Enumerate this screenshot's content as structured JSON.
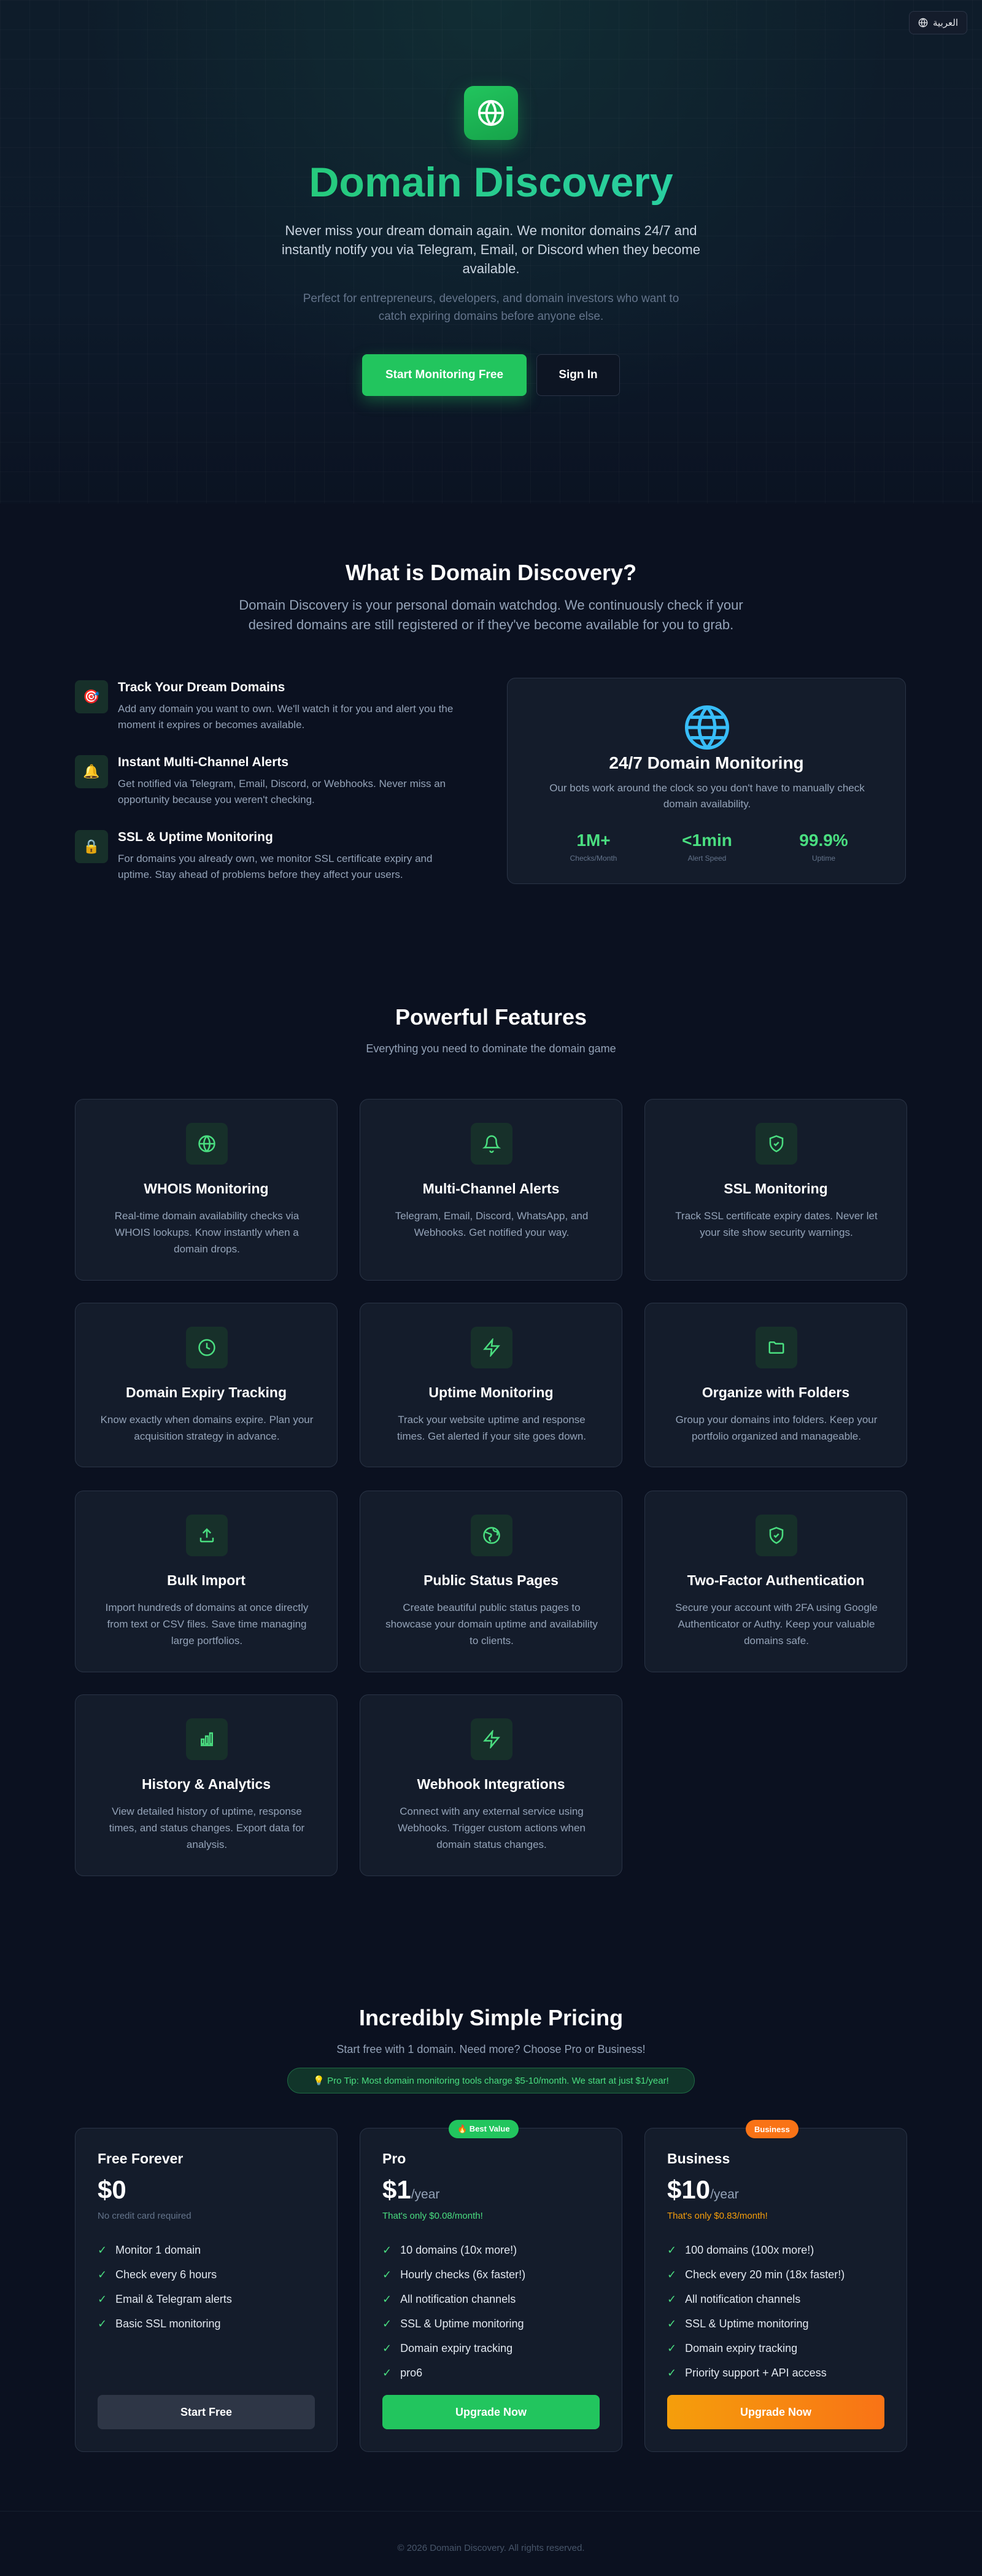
{
  "lang_button": {
    "label": "العربية"
  },
  "hero": {
    "title": "Domain Discovery",
    "subtitle": "Never miss your dream domain again. We monitor domains 24/7 and instantly notify you via Telegram, Email, or Discord when they become available.",
    "subtitle2": "Perfect for entrepreneurs, developers, and domain investors who want to catch expiring domains before anyone else.",
    "cta_primary": "Start Monitoring Free",
    "cta_secondary": "Sign In"
  },
  "what": {
    "title": "What is Domain Discovery?",
    "subtitle": "Domain Discovery is your personal domain watchdog. We continuously check if your desired domains are still registered or if they've become available for you to grab.",
    "items": [
      {
        "icon": "target-icon",
        "emoji": "🎯",
        "title": "Track Your Dream Domains",
        "desc": "Add any domain you want to own. We'll watch it for you and alert you the moment it expires or becomes available."
      },
      {
        "icon": "bell-icon",
        "emoji": "🔔",
        "title": "Instant Multi-Channel Alerts",
        "desc": "Get notified via Telegram, Email, Discord, or Webhooks. Never miss an opportunity because you weren't checking."
      },
      {
        "icon": "lock-icon",
        "emoji": "🔒",
        "title": "SSL & Uptime Monitoring",
        "desc": "For domains you already own, we monitor SSL certificate expiry and uptime. Stay ahead of problems before they affect your users."
      }
    ],
    "card": {
      "title": "24/7 Domain Monitoring",
      "desc": "Our bots work around the clock so you don't have to manually check domain availability.",
      "stats": [
        {
          "value": "1M+",
          "label": "Checks/Month"
        },
        {
          "value": "<1min",
          "label": "Alert Speed"
        },
        {
          "value": "99.9%",
          "label": "Uptime"
        }
      ]
    }
  },
  "features": {
    "title": "Powerful Features",
    "subtitle": "Everything you need to dominate the domain game",
    "items": [
      {
        "icon": "globe-icon",
        "title": "WHOIS Monitoring",
        "desc": "Real-time domain availability checks via WHOIS lookups. Know instantly when a domain drops."
      },
      {
        "icon": "bell-icon",
        "title": "Multi-Channel Alerts",
        "desc": "Telegram, Email, Discord, WhatsApp, and Webhooks. Get notified your way."
      },
      {
        "icon": "shield-icon",
        "title": "SSL Monitoring",
        "desc": "Track SSL certificate expiry dates. Never let your site show security warnings."
      },
      {
        "icon": "clock-icon",
        "title": "Domain Expiry Tracking",
        "desc": "Know exactly when domains expire. Plan your acquisition strategy in advance."
      },
      {
        "icon": "bolt-icon",
        "title": "Uptime Monitoring",
        "desc": "Track your website uptime and response times. Get alerted if your site goes down."
      },
      {
        "icon": "folder-icon",
        "title": "Organize with Folders",
        "desc": "Group your domains into folders. Keep your portfolio organized and manageable."
      },
      {
        "icon": "upload-icon",
        "title": "Bulk Import",
        "desc": "Import hundreds of domains at once directly from text or CSV files. Save time managing large portfolios."
      },
      {
        "icon": "world-icon",
        "title": "Public Status Pages",
        "desc": "Create beautiful public status pages to showcase your domain uptime and availability to clients."
      },
      {
        "icon": "shield-icon",
        "title": "Two-Factor Authentication",
        "desc": "Secure your account with 2FA using Google Authenticator or Authy. Keep your valuable domains safe."
      },
      {
        "icon": "chart-icon",
        "title": "History & Analytics",
        "desc": "View detailed history of uptime, response times, and status changes. Export data for analysis."
      },
      {
        "icon": "bolt-icon",
        "title": "Webhook Integrations",
        "desc": "Connect with any external service using Webhooks. Trigger custom actions when domain status changes."
      }
    ]
  },
  "pricing": {
    "title": "Incredibly Simple Pricing",
    "subtitle": "Start free with 1 domain. Need more? Choose Pro or Business!",
    "tip": "💡 Pro Tip: Most domain monitoring tools charge $5-10/month. We start at just $1/year!",
    "plans": [
      {
        "name": "Free Forever",
        "price": "$0",
        "period": "",
        "note": "No credit card required",
        "badge": "",
        "features": [
          "Monitor 1 domain",
          "Check every 6 hours",
          "Email & Telegram alerts",
          "Basic SSL monitoring"
        ],
        "button": "Start Free"
      },
      {
        "name": "Pro",
        "price": "$1",
        "period": "/year",
        "note": "That's only $0.08/month!",
        "badge": "🔥 Best Value",
        "features": [
          "10 domains (10x more!)",
          "Hourly checks (6x faster!)",
          "All notification channels",
          "SSL & Uptime monitoring",
          "Domain expiry tracking",
          "pro6"
        ],
        "button": "Upgrade Now"
      },
      {
        "name": "Business",
        "price": "$10",
        "period": "/year",
        "note": "That's only $0.83/month!",
        "badge": "Business",
        "features": [
          "100 domains (100x more!)",
          "Check every 20 min (18x faster!)",
          "All notification channels",
          "SSL & Uptime monitoring",
          "Domain expiry tracking",
          "Priority support + API access"
        ],
        "button": "Upgrade Now"
      }
    ]
  },
  "footer": {
    "text": "© 2026 Domain Discovery. All rights reserved."
  },
  "colors": {
    "accent": "#22c55e",
    "business": "#f97316",
    "bg": "#0b1120",
    "card": "#141c2b"
  }
}
